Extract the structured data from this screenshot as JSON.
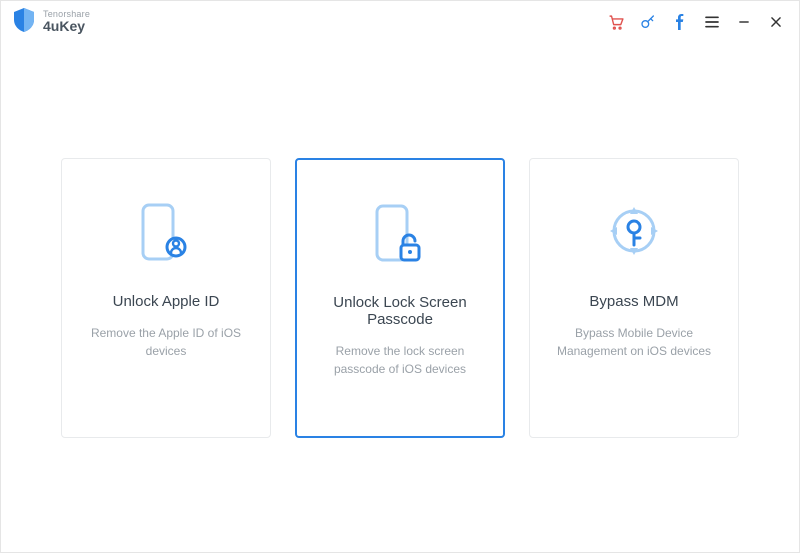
{
  "brand": {
    "company": "Tenorshare",
    "product": "4uKey"
  },
  "cards": [
    {
      "title": "Unlock Apple ID",
      "desc": "Remove the Apple ID of iOS devices",
      "selected": false
    },
    {
      "title": "Unlock Lock Screen Passcode",
      "desc": "Remove the lock screen passcode of iOS devices",
      "selected": true
    },
    {
      "title": "Bypass MDM",
      "desc": "Bypass Mobile Device Management on iOS devices",
      "selected": false
    }
  ]
}
